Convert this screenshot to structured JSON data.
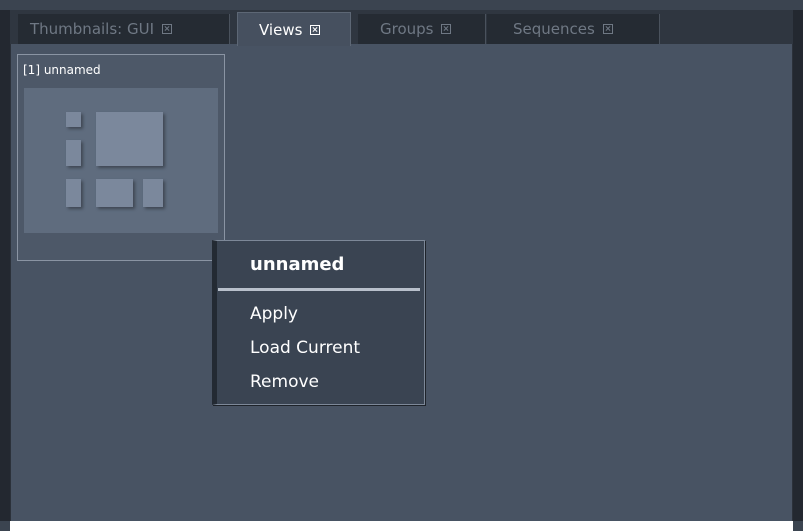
{
  "tabs": [
    {
      "label": "Thumbnails: GUI",
      "active": false
    },
    {
      "label": "Views",
      "active": true
    },
    {
      "label": "Groups",
      "active": false
    },
    {
      "label": "Sequences",
      "active": false
    }
  ],
  "icons": {
    "tab_close": "close-box-icon",
    "thumbnail": "layout-icon"
  },
  "view_card": {
    "title": "[1] unnamed"
  },
  "context_menu": {
    "title": "unnamed",
    "items": [
      "Apply",
      "Load Current",
      "Remove"
    ]
  },
  "colors": {
    "panel_bg": "#485363",
    "tabbar_bg": "#2f3640",
    "menu_bg": "#3a4452"
  }
}
